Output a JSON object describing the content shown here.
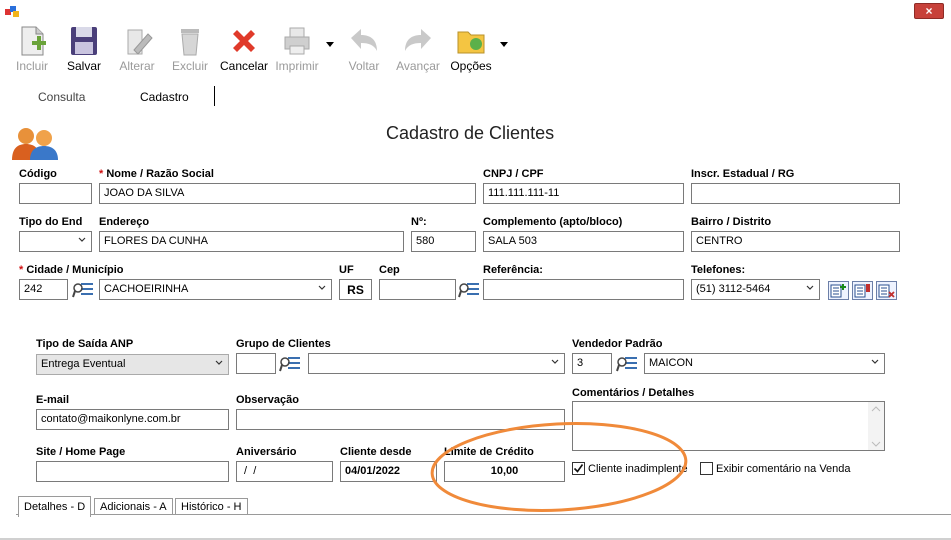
{
  "toolbar": {
    "incluir": "Incluir",
    "salvar": "Salvar",
    "alterar": "Alterar",
    "excluir": "Excluir",
    "cancelar": "Cancelar",
    "imprimir": "Imprimir",
    "voltar": "Voltar",
    "avancar": "Avançar",
    "opcoes": "Opções"
  },
  "page_tabs": {
    "consulta": "Consulta",
    "cadastro": "Cadastro"
  },
  "header": {
    "title": "Cadastro de Clientes"
  },
  "form": {
    "codigo": {
      "label": "Código",
      "value": ""
    },
    "nome": {
      "req": "*",
      "label": "Nome / Razão Social",
      "value": "JOAO DA SILVA"
    },
    "cnpj": {
      "label": "CNPJ / CPF",
      "value": "111.111.111-11"
    },
    "inscr": {
      "label": "Inscr. Estadual / RG",
      "value": ""
    },
    "tipo_end": {
      "label": "Tipo do End",
      "value": ""
    },
    "endereco": {
      "label": "Endereço",
      "value": "FLORES DA CUNHA"
    },
    "numero": {
      "label": "Nº:",
      "value": "580"
    },
    "complemento": {
      "label": "Complemento (apto/bloco)",
      "value": "SALA 503"
    },
    "bairro": {
      "label": "Bairro / Distrito",
      "value": "CENTRO"
    },
    "cidade": {
      "req": "*",
      "label": "Cidade / Município",
      "code": "242",
      "value": "CACHOEIRINHA"
    },
    "uf": {
      "label": "UF",
      "value": "RS"
    },
    "cep": {
      "label": "Cep",
      "value": ""
    },
    "referencia": {
      "label": "Referência:",
      "value": ""
    },
    "telefones": {
      "label": "Telefones:",
      "value": "(51) 3112-5464"
    },
    "tipo_saida": {
      "label": "Tipo de Saída ANP",
      "value": "Entrega Eventual"
    },
    "grupo": {
      "label": "Grupo de Clientes",
      "code": "",
      "value": ""
    },
    "vendedor": {
      "label": "Vendedor Padrão",
      "code": "3",
      "value": "MAICON"
    },
    "email": {
      "label": "E-mail",
      "value": "contato@maikonlyne.com.br"
    },
    "observacao": {
      "label": "Observação",
      "value": ""
    },
    "comentarios": {
      "label": "Comentários / Detalhes",
      "value": ""
    },
    "site": {
      "label": "Site / Home Page",
      "value": ""
    },
    "aniversario": {
      "label": "Aniversário",
      "value": " /  /"
    },
    "cliente_desde": {
      "label": "Cliente desde",
      "value": "04/01/2022"
    },
    "limite": {
      "label": "Limite de Crédito",
      "value": "10,00"
    },
    "inadimplente": {
      "label": "Cliente inadimplente",
      "checked": true
    },
    "exibir_comentario": {
      "label": "Exibir comentário na Venda",
      "checked": false
    }
  },
  "bottom_tabs": {
    "detalhes": "Detalhes - D",
    "adicionais": "Adicionais - A",
    "historico": "Histórico - H"
  },
  "colors": {
    "annotation_oval": "#f08a3a",
    "close_button": "#c7413a",
    "required_marker": "#d01010"
  }
}
